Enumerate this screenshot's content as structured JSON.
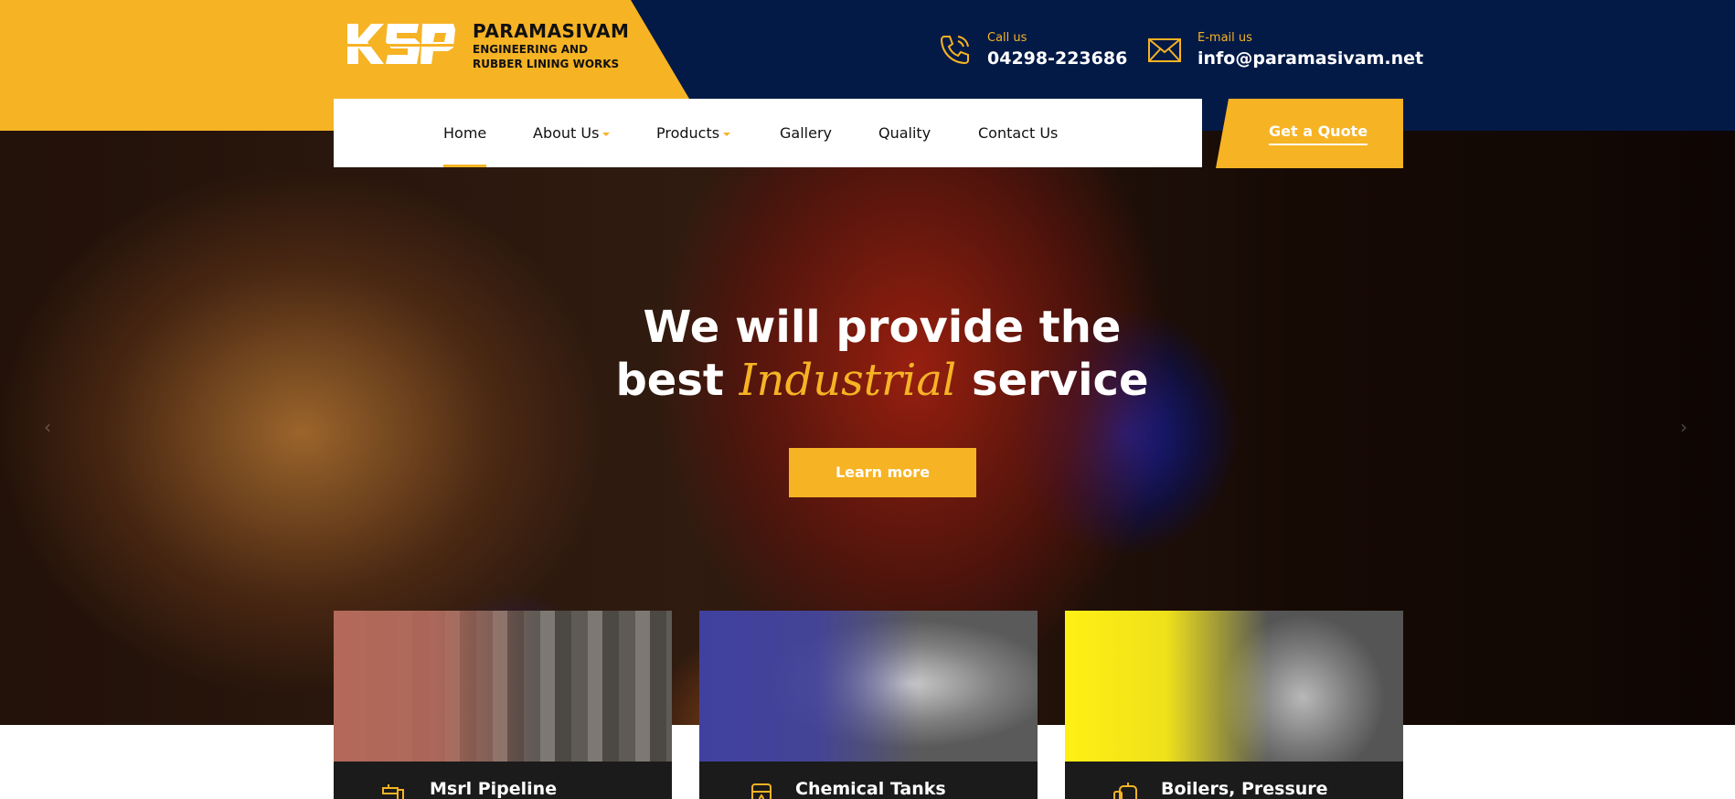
{
  "brand": {
    "mark": "KSP",
    "name": "PARAMASIVAM",
    "subtitle_line1": "ENGINEERING AND",
    "subtitle_line2": "RUBBER LINING WORKS"
  },
  "contact": {
    "phone_label": "Call us",
    "phone_value": "04298-223686",
    "email_label": "E-mail us",
    "email_value": "info@paramasivam.net"
  },
  "nav": {
    "items": [
      {
        "label": "Home",
        "active": true
      },
      {
        "label": "About Us",
        "dropdown": true
      },
      {
        "label": "Products",
        "dropdown": true
      },
      {
        "label": "Gallery"
      },
      {
        "label": "Quality"
      },
      {
        "label": "Contact Us"
      }
    ],
    "quote_label": "Get a Quote"
  },
  "hero": {
    "line1": "We will provide the",
    "line2_pre": "best ",
    "line2_accent": "Industrial",
    "line2_post": " service",
    "button_label": "Learn more"
  },
  "cards": [
    {
      "title": "Msrl Pipeline",
      "icon": "pipeline-icon",
      "tint": "#b4695a"
    },
    {
      "title": "Chemical Tanks",
      "icon": "chemical-tank-icon",
      "tint": "#4040a0"
    },
    {
      "title": "Boilers, Pressure",
      "icon": "boiler-icon",
      "tint": "#fff014"
    }
  ],
  "colors": {
    "accent": "#f6b324",
    "navy": "#031a47",
    "caption_bg": "#1b1b1b"
  }
}
